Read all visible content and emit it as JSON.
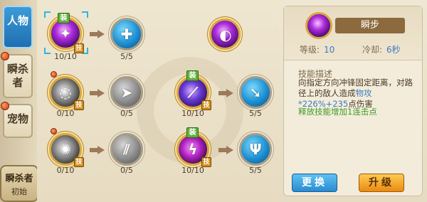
{
  "tabs": [
    {
      "label": "人物",
      "active": true
    },
    {
      "label": "瞬杀者",
      "active": false
    },
    {
      "label": "宠物",
      "active": false
    }
  ],
  "character": {
    "name": "瞬杀者",
    "stage": "初始"
  },
  "skills": {
    "row1": [
      {
        "count": "10/10",
        "equipped_label": "装",
        "skill_label": "技"
      },
      {
        "count": "5/5"
      }
    ],
    "row2": [
      {
        "count": "0/10",
        "skill_label": "技"
      },
      {
        "count": "0/5"
      },
      {
        "count": "10/10",
        "equipped_label": "装",
        "skill_label": "技"
      },
      {
        "count": "5/5"
      }
    ],
    "row3": [
      {
        "count": "0/10",
        "skill_label": "技"
      },
      {
        "count": "0/5"
      },
      {
        "count": "10/10",
        "equipped_label": "装",
        "skill_label": "技"
      },
      {
        "count": "5/5"
      }
    ]
  },
  "detail": {
    "name": "瞬步",
    "level_label": "等级:",
    "level_value": "10",
    "cooldown_label": "冷却:",
    "cooldown_value": "6秒",
    "desc_title": "技能描述",
    "desc_part1": "向指定方向冲锋固定距离，对路径上的敌人造成",
    "desc_highlight": "物攻*226%+235",
    "desc_part2": "点伤害",
    "desc_extra": "释放技能增加1连击点"
  },
  "buttons": {
    "change": "更换",
    "upgrade": "升级"
  }
}
